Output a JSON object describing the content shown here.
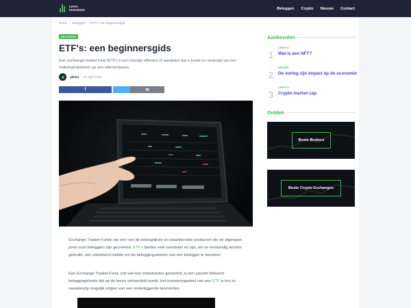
{
  "header": {
    "logo_line1": "Leren",
    "logo_line2": "Investeren",
    "nav": [
      "Beleggen",
      "Crypto",
      "Nieuws",
      "Contact"
    ]
  },
  "breadcrumb": [
    "Home",
    "›",
    "Beleggen",
    "›",
    "ETF's: een beginnersgids"
  ],
  "article": {
    "badge": "BELEGGEN",
    "title": "ETF's: een beginnersgids",
    "lead": "Een exchange-traded fund (ETF) is een mandje effecten of aandelen dat u koopt en verkoopt via een makelaarskantoor op een effectenbeurs.",
    "author": "admin",
    "date": "– 20 April 2022",
    "p1_a": "Exchange Traded Funds zijn een van de belangrijkste en waardevolste producten die de afgelopen jaren voor beleggers zijn gecreëerd. ",
    "p1_link": "ETF's",
    "p1_b": " bieden veel voordelen en zijn, als ze verstandig worden gebruikt, een uitstekend middel om de beleggingsdoelen van een belegger te bereiken.",
    "p2_a": "Een Exchange Traded Fund, ook wel een indextracker genoemd, is een passief beheerd beleggingsfonds dat op de beurs verhandeld wordt. Het investeringsdoel van een ",
    "p2_link": "ETF",
    "p2_b": " is het zo nauwkeurig mogelijk volgen van een onderliggende beursindex."
  },
  "share": {
    "facebook_icon": "f",
    "twitter_icon": "🐦",
    "mail_icon": "✉"
  },
  "sidebar": {
    "recommended_title": "Aanbevolen",
    "items": [
      {
        "num": "1",
        "category": "CRYPTO",
        "title": "Wat is een NFT?"
      },
      {
        "num": "2",
        "category": "NIEUWS",
        "title": "De oorlog zijn impact op de economie"
      },
      {
        "num": "3",
        "category": "CRYPTO",
        "title": "Crypto market cap"
      }
    ],
    "discover_title": "Ontdek",
    "promo1": "Beste Brokers",
    "promo2": "Beste Crypto Exchanges"
  },
  "colors": {
    "accent": "#3fb950",
    "navy": "#1f2336",
    "link": "#4b3fd0"
  }
}
